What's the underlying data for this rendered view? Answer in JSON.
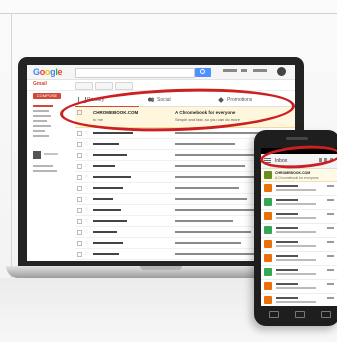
{
  "gmail": {
    "logo_letters": [
      "G",
      "o",
      "o",
      "g",
      "l",
      "e"
    ],
    "section_label": "Gmail",
    "compose_label": "COMPOSE",
    "tabs": [
      {
        "label": "Primary",
        "icon": "inbox-icon"
      },
      {
        "label": "Social",
        "icon": "people-icon"
      },
      {
        "label": "Promotions",
        "icon": "tag-icon"
      }
    ],
    "promo_email": {
      "sender": "CHROMEBOOK.COM",
      "sender_sub": "to me",
      "title": "A Chromebook for everyone",
      "snippet": "Simple and fast, so you can do more"
    }
  },
  "phone": {
    "appbar_label": "Inbox",
    "promo": {
      "line1": "CHROMEBOOK.COM",
      "line2": "A Chromebook for everyone"
    }
  },
  "colors": {
    "highlight": "#cc2020",
    "gmail_red": "#d14836",
    "promo_bg": "#fff7dd",
    "search_blue": "#4d90fe"
  },
  "phone_avatar_colors": [
    "#e8710a",
    "#34a853",
    "#e8710a",
    "#34a853",
    "#e8710a",
    "#e8710a",
    "#34a853",
    "#e8710a",
    "#e8710a"
  ]
}
